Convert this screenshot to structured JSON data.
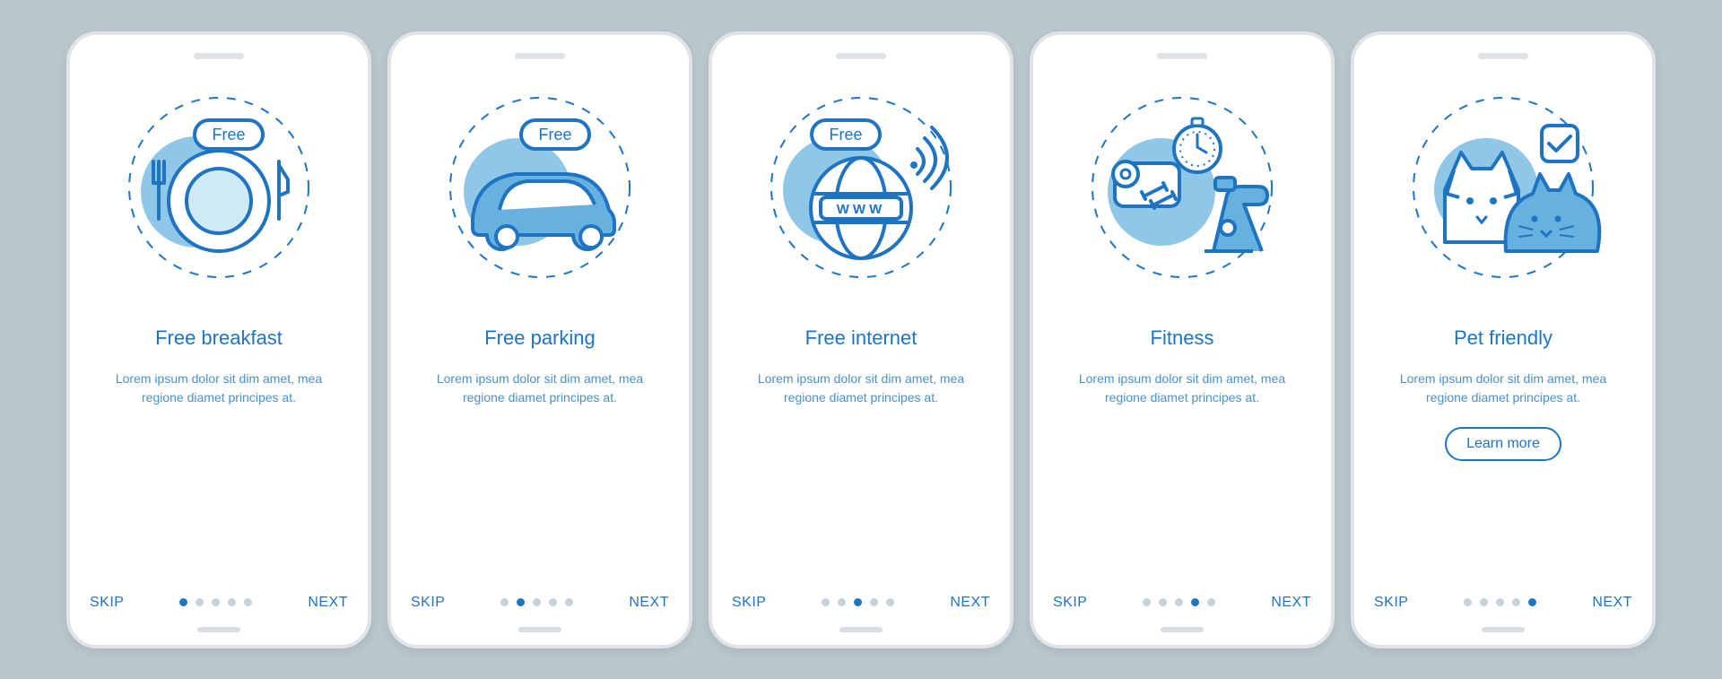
{
  "common": {
    "skip": "SKIP",
    "next": "NEXT",
    "body": "Lorem ipsum dolor sit dim amet, mea regione diamet principes at.",
    "learn_more": "Learn more",
    "free_badge": "Free",
    "www_label": "WWW"
  },
  "colors": {
    "primary": "#1f74c2",
    "accentLight": "#8fc7e8",
    "accentFill": "#66b1e0",
    "muted": "#c6d2da"
  },
  "screens": [
    {
      "id": "breakfast",
      "title": "Free breakfast",
      "illustration": "breakfast-icon",
      "activeDot": 0,
      "cta": false
    },
    {
      "id": "parking",
      "title": "Free parking",
      "illustration": "car-icon",
      "activeDot": 1,
      "cta": false
    },
    {
      "id": "internet",
      "title": "Free internet",
      "illustration": "globe-icon",
      "activeDot": 2,
      "cta": false
    },
    {
      "id": "fitness",
      "title": "Fitness",
      "illustration": "fitness-icon",
      "activeDot": 3,
      "cta": false
    },
    {
      "id": "pet",
      "title": "Pet friendly",
      "illustration": "pet-icon",
      "activeDot": 4,
      "cta": true
    }
  ]
}
